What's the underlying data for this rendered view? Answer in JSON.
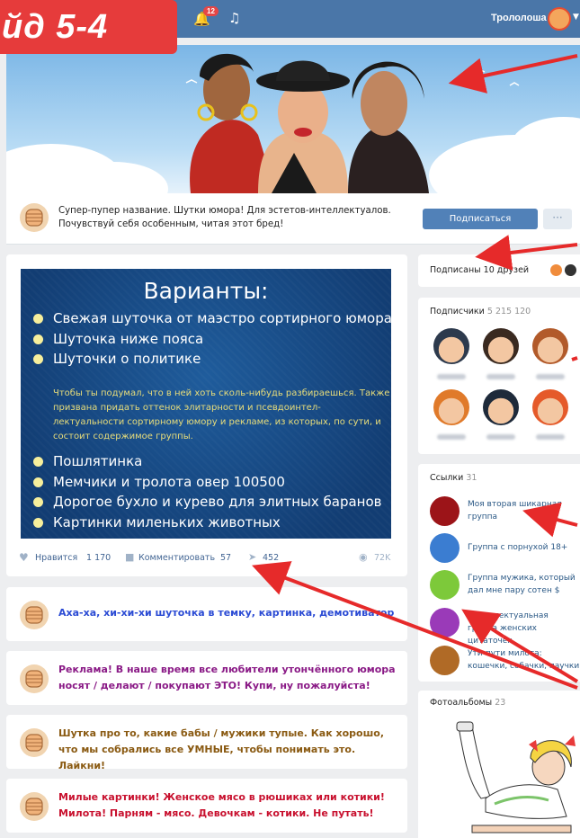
{
  "slide_label": "йд 5-4",
  "topbar": {
    "notification_count": "12",
    "username": "Трололоша",
    "brand_color": "#4a76a8"
  },
  "group": {
    "description": "Супер-пупер название. Шутки юмора! Для эстетов-интеллектуалов. Почувствуй себя особенным, читая этот бред!",
    "subscribe_label": "Подписаться",
    "more_label": "···"
  },
  "post": {
    "image_title": "Варианты:",
    "items_top": [
      "Свежая шуточка от маэстро сортирного юмора",
      "Шуточка ниже пояса",
      "Шуточки о политике"
    ],
    "note": "Чтобы ты подумал, что в ней хоть сколь-нибудь разбираешься. Также призвана придать оттенок элитарности и псевдоинтел-лектуальности сортирному юмору и рекламе, из которых, по сути, и состоит содержимое группы.",
    "items_bottom": [
      "Пошлятинка",
      "Мемчики и тролота овер 100500",
      "Дорогое бухло и курево для элитных баранов",
      "Картинки миленьких животных"
    ],
    "like_label": "Нравится",
    "like_count": "1 170",
    "comment_label": "Комментировать",
    "comment_count": "57",
    "share_count": "452",
    "views": "72K"
  },
  "comments": [
    {
      "text": "Аха-ха, хи-хи-хи шуточка в темку, картинка, демотиватор",
      "color": "#2b4bd4"
    },
    {
      "text": "Реклама! В наше время все любители утончённого юмора носят / делают / покупают ЭТО!     Купи, ну пожалуйста!",
      "color": "#8a1a86"
    },
    {
      "text": "Шутка про то, какие бабы / мужики тупые. Как хорошо, что мы собрались все УМНЫЕ, чтобы понимать это.     Лайкни!",
      "color": "#8a5a12"
    },
    {
      "text": "Милые картинки! Женское мясо в рюшиках или котики! Милота! Парням - мясо. Девочкам - котики. Не путать!",
      "color": "#c8102e"
    }
  ],
  "sidebar": {
    "friends_label": "Подписаны 10 друзей",
    "subscribers_label": "Подписчики",
    "subscribers_count": "5 215 120",
    "links_label": "Ссылки",
    "links_count": "31",
    "links": [
      {
        "text": "Моя вторая шикарная группа",
        "color": "#9c1418"
      },
      {
        "text": "Группа с порнухой 18+",
        "color": "#3b7dd1"
      },
      {
        "text": "Группа мужика, который дал мне пару сотен $",
        "color": "#7dc93a"
      },
      {
        "text": "Интеллектуальная группа женских цитаточек",
        "color": "#9a3ab8"
      },
      {
        "text": "Ути-пути милота: кошечки, собачки, паучки",
        "color": "#b06a26"
      }
    ],
    "albums_label": "Фотоальбомы",
    "albums_count": "23"
  }
}
